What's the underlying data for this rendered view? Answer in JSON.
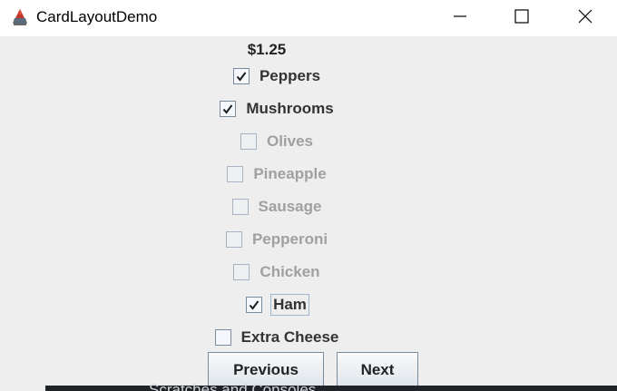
{
  "window": {
    "title": "CardLayoutDemo",
    "app_icon": "java-cup-icon",
    "controls": [
      "minimize-icon",
      "maximize-icon",
      "close-icon"
    ]
  },
  "price": "$1.25",
  "toppings": [
    {
      "label": "Peppers",
      "checked": true,
      "enabled": true
    },
    {
      "label": "Mushrooms",
      "checked": true,
      "enabled": true
    },
    {
      "label": "Olives",
      "checked": false,
      "enabled": false
    },
    {
      "label": "Pineapple",
      "checked": false,
      "enabled": false
    },
    {
      "label": "Sausage",
      "checked": false,
      "enabled": false
    },
    {
      "label": "Pepperoni",
      "checked": false,
      "enabled": false
    },
    {
      "label": "Chicken",
      "checked": false,
      "enabled": false
    },
    {
      "label": "Ham",
      "checked": true,
      "enabled": true,
      "focused": true
    },
    {
      "label": "Extra Cheese",
      "checked": false,
      "enabled": true
    }
  ],
  "buttons": {
    "previous": "Previous",
    "next": "Next"
  },
  "background_window": {
    "partial_text": "Scratches and Consoles"
  }
}
